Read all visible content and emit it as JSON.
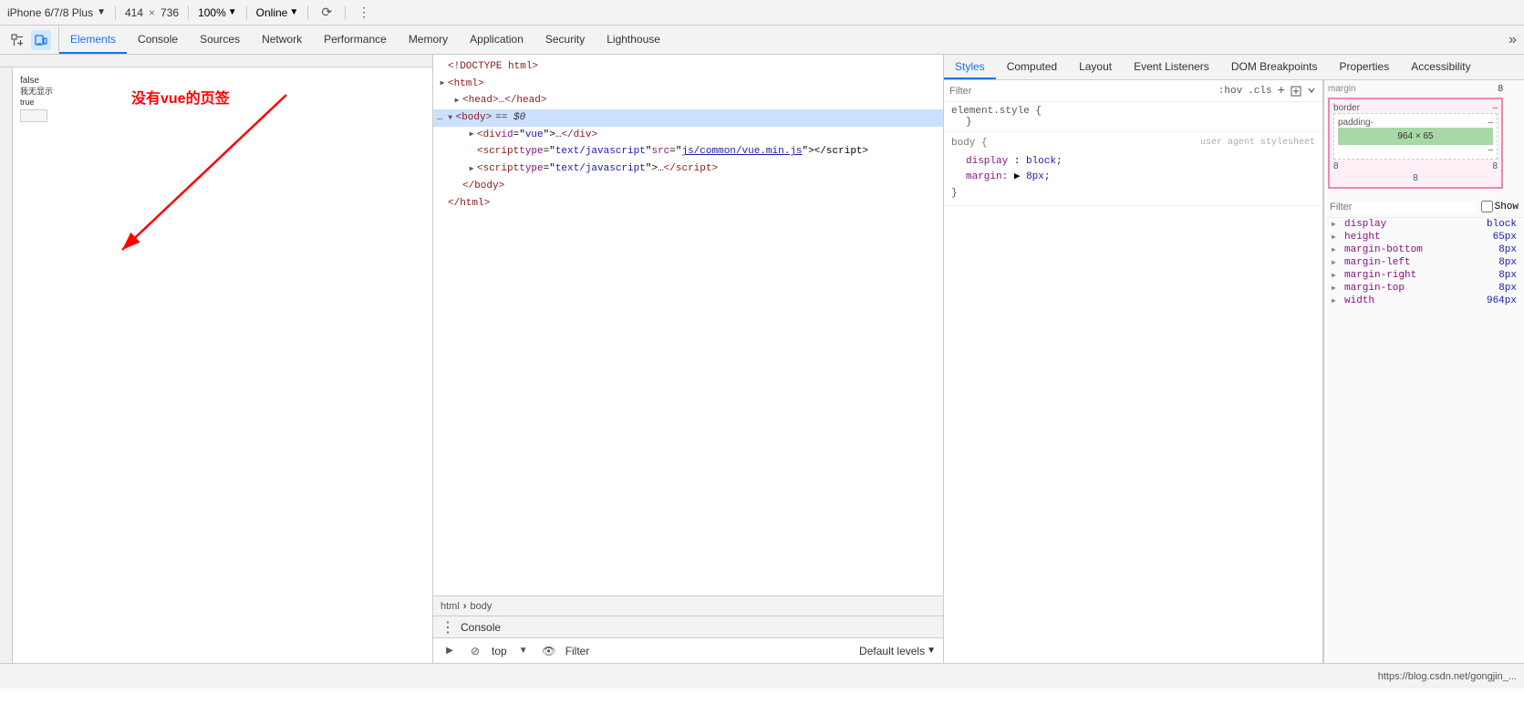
{
  "toolbar": {
    "device": "iPhone 6/7/8 Plus",
    "width": "414",
    "height": "736",
    "zoom": "100%",
    "network": "Online",
    "more_icon": "⋮"
  },
  "devtools_tabs": [
    {
      "id": "elements",
      "label": "Elements",
      "active": true
    },
    {
      "id": "console",
      "label": "Console",
      "active": false
    },
    {
      "id": "sources",
      "label": "Sources",
      "active": false
    },
    {
      "id": "network",
      "label": "Network",
      "active": false
    },
    {
      "id": "performance",
      "label": "Performance",
      "active": false
    },
    {
      "id": "memory",
      "label": "Memory",
      "active": false
    },
    {
      "id": "application",
      "label": "Application",
      "active": false
    },
    {
      "id": "security",
      "label": "Security",
      "active": false
    },
    {
      "id": "lighthouse",
      "label": "Lighthouse",
      "active": false
    }
  ],
  "dom_tree": {
    "lines": [
      {
        "indent": 0,
        "triangle": "",
        "content": "<!DOCTYPE html>",
        "type": "doctype",
        "selected": false
      },
      {
        "indent": 0,
        "triangle": "▶",
        "content": "<html>",
        "type": "tag",
        "selected": false
      },
      {
        "indent": 1,
        "triangle": "▶",
        "content": "<head>…</head>",
        "type": "tag",
        "selected": false
      },
      {
        "indent": 0,
        "triangle": "▼",
        "content": "<body> == $0",
        "type": "tag-selected",
        "selected": true
      },
      {
        "indent": 1,
        "triangle": "▶",
        "content": "<div id=\"vue\">…</div>",
        "type": "tag",
        "selected": false
      },
      {
        "indent": 1,
        "triangle": "",
        "content": "<script type=\"text/javascript\" src=\"js/common/vue.min.js\"></script>",
        "type": "script",
        "selected": false
      },
      {
        "indent": 1,
        "triangle": "▶",
        "content": "<script type=\"text/javascript\">…</script>",
        "type": "script",
        "selected": false
      },
      {
        "indent": 1,
        "triangle": "",
        "content": "</body>",
        "type": "tag-close",
        "selected": false
      },
      {
        "indent": 0,
        "triangle": "",
        "content": "</html>",
        "type": "tag-close",
        "selected": false
      }
    ],
    "breadcrumb": [
      "html",
      "body"
    ]
  },
  "styles_tabs": [
    {
      "id": "styles",
      "label": "Styles",
      "active": true
    },
    {
      "id": "computed",
      "label": "Computed",
      "active": false
    },
    {
      "id": "layout",
      "label": "Layout",
      "active": false
    },
    {
      "id": "event-listeners",
      "label": "Event Listeners",
      "active": false
    },
    {
      "id": "dom-breakpoints",
      "label": "DOM Breakpoints",
      "active": false
    },
    {
      "id": "properties",
      "label": "Properties",
      "active": false
    },
    {
      "id": "accessibility",
      "label": "Accessibility",
      "active": false
    }
  ],
  "styles": {
    "filter_placeholder": "Filter",
    "element_style": {
      "selector": "element.style {",
      "close": "}"
    },
    "body_rule": {
      "selector": "body {",
      "origin": "user agent stylesheet",
      "props": [
        {
          "name": "display",
          "value": "block;"
        },
        {
          "name": "margin:",
          "value": "▶ 8px;"
        }
      ],
      "close": "}"
    }
  },
  "box_model": {
    "title": "",
    "margin": "8",
    "border": "–",
    "padding_label": "padding-",
    "dimensions": "964 × 65",
    "bottom": "–",
    "right": "–",
    "value_8_left": "8",
    "value_8_right": "8"
  },
  "computed": {
    "filter_placeholder": "Filter",
    "show_all": "Show",
    "props": [
      {
        "name": "display",
        "value": "block"
      },
      {
        "name": "height",
        "value": "65px"
      },
      {
        "name": "margin-bottom",
        "value": "8px"
      },
      {
        "name": "margin-left",
        "value": "8px"
      },
      {
        "name": "margin-right",
        "value": "8px"
      },
      {
        "name": "margin-top",
        "value": "8px"
      },
      {
        "name": "width",
        "value": "964px"
      }
    ]
  },
  "console_bar": {
    "label": "Console"
  },
  "console_input": {
    "top_label": "top",
    "filter_placeholder": "Filter",
    "level": "Default levels"
  },
  "annotation": {
    "text": "没有vue的页签",
    "color": "red"
  },
  "bottom_url": "https://blog.csdn.net/gongjin_...",
  "page_preview": {
    "false_label": "false",
    "sub_label1": "我无显示",
    "sub_label2": "true",
    "small_box_label": "■"
  }
}
